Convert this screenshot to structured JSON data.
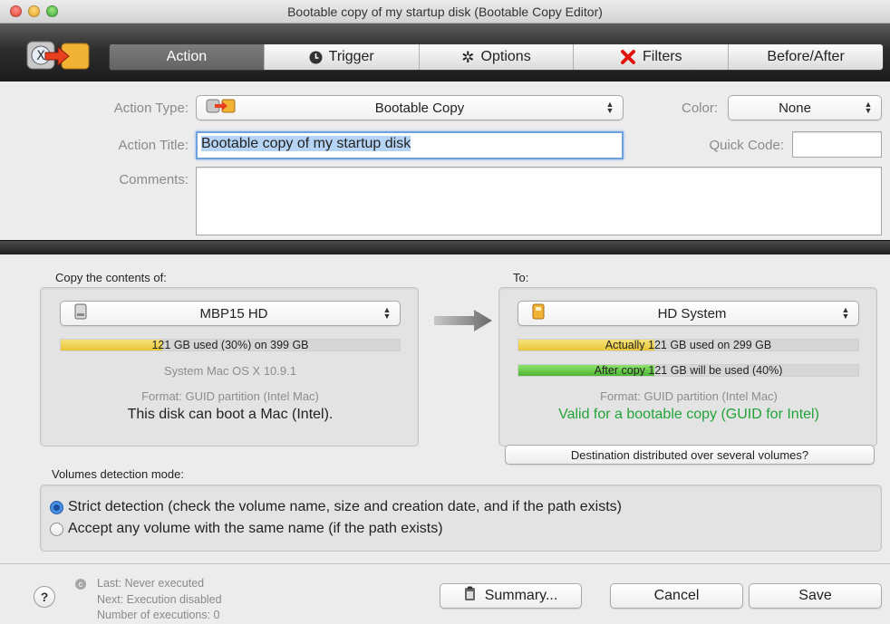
{
  "window": {
    "title": "Bootable copy of my startup disk (Bootable Copy Editor)"
  },
  "tabs": [
    {
      "label": "Action",
      "icon": "action-icon",
      "selected": true
    },
    {
      "label": "Trigger",
      "icon": "clock-icon",
      "selected": false
    },
    {
      "label": "Options",
      "icon": "gear-icon",
      "selected": false
    },
    {
      "label": "Filters",
      "icon": "x-mark-icon",
      "selected": false
    },
    {
      "label": "Before/After",
      "icon": "",
      "selected": false
    }
  ],
  "form": {
    "action_type_label": "Action Type:",
    "action_type_value": "Bootable Copy",
    "color_label": "Color:",
    "color_value": "None",
    "action_title_label": "Action Title:",
    "action_title_value": "Bootable copy of my startup disk",
    "quick_code_label": "Quick Code:",
    "quick_code_value": "",
    "comments_label": "Comments:",
    "comments_value": ""
  },
  "source": {
    "section_label": "Copy the contents of:",
    "volume_name": "MBP15 HD",
    "usage_text": "121 GB used (30%) on 399 GB",
    "usage_fraction": 0.3,
    "system_text": "System Mac OS X 10.9.1",
    "format_text": "Format: GUID partition (Intel Mac)",
    "boot_text": "This disk can boot a Mac (Intel)."
  },
  "destination": {
    "section_label": "To:",
    "volume_name": "HD System",
    "actual_usage_text": "Actually 121 GB used on 299 GB",
    "actual_usage_fraction": 0.4,
    "after_copy_text": "After copy 121 GB will be used (40%)",
    "after_copy_fraction": 0.4,
    "format_text": "Format: GUID partition (Intel Mac)",
    "valid_text": "Valid for a bootable copy (GUID for Intel)",
    "distributed_button": "Destination distributed over several volumes?"
  },
  "detection": {
    "label": "Volumes detection mode:",
    "options": [
      {
        "label": "Strict detection (check the volume name, size and creation date, and if the path exists)",
        "selected": true
      },
      {
        "label": "Accept any volume with the same name (if the path exists)",
        "selected": false
      }
    ]
  },
  "footer": {
    "help": "?",
    "status_lines": [
      "Last: Never executed",
      "Next: Execution disabled",
      "Number of executions: 0"
    ],
    "summary_button": "Summary...",
    "cancel_button": "Cancel",
    "save_button": "Save"
  },
  "colors": {
    "selected_tab": "#6e6e6e",
    "usage_bar_yellow": "#eed14a",
    "usage_bar_green": "#62c644",
    "valid_text_green": "#22a33a",
    "focus_ring": "#6ea1de"
  }
}
